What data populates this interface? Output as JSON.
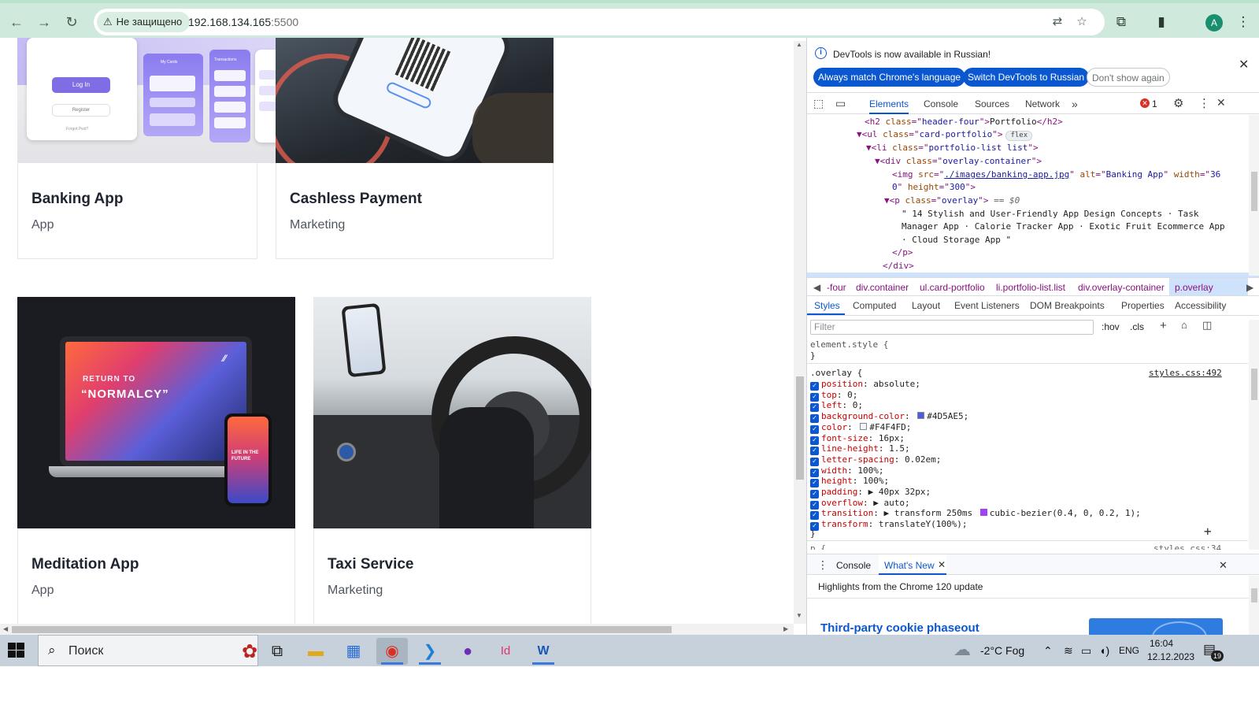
{
  "browser": {
    "security_label": "Не защищено",
    "url_host": "192.168.134.165",
    "url_port": ":5500",
    "profile_initial": "A",
    "icons": [
      "back-arrow-icon",
      "forward-arrow-icon",
      "reload-icon",
      "translate-icon",
      "star-icon",
      "extensions-icon",
      "side-panel-icon",
      "menu-dots-icon"
    ]
  },
  "page": {
    "cards": [
      {
        "title": "Banking App",
        "category": "App",
        "image_alt": "Banking App",
        "image_text": [
          "Log In",
          "Register",
          "My Cards",
          "Transactions",
          "Forgot Pwd?"
        ]
      },
      {
        "title": "Cashless Payment",
        "category": "Marketing"
      },
      {
        "title": "Meditation App",
        "category": "App",
        "image_text": [
          "RETURN TO",
          "“NORMALCY”",
          "LIFE IN THE FUTURE"
        ]
      },
      {
        "title": "Taxi Service",
        "category": "Marketing"
      }
    ]
  },
  "devtools": {
    "info_text": "DevTools is now available in Russian!",
    "btn_match": "Always match Chrome's language",
    "btn_switch": "Switch DevTools to Russian",
    "btn_dismiss": "Don't show again",
    "tabs": [
      "Elements",
      "Console",
      "Sources",
      "Network"
    ],
    "active_tab": "Elements",
    "error_count": "1",
    "dom": {
      "h2_class": "header-four",
      "h2_text": "Portfolio",
      "ul_class": "card-portfolio",
      "flex_badge": "flex",
      "li_class": "portfolio-list list",
      "div_class": "overlay-container",
      "img_src": "./images/banking-app.jpg",
      "img_alt": "Banking App",
      "img_width": "360",
      "img_height": "300",
      "p_class": "overlay",
      "selected_marker": "== $0",
      "p_text_1": "\" 14 Stylish and User-Friendly App Design Concepts · Task",
      "p_text_2": "Manager App · Calorie Tracker App · Exotic Fruit Ecommerce App",
      "p_text_3": "· Cloud Storage App \""
    },
    "breadcrumbs": [
      "-four",
      "div.container",
      "ul.card-portfolio",
      "li.portfolio-list.list",
      "div.overlay-container",
      "p.overlay"
    ],
    "styles_tabs": [
      "Styles",
      "Computed",
      "Layout",
      "Event Listeners",
      "DOM Breakpoints",
      "Properties",
      "Accessibility"
    ],
    "filter_placeholder": "Filter",
    "hov": ":hov",
    "cls": ".cls",
    "element_style": "element.style {",
    "rule_selector": ".overlay {",
    "rule_source": "styles.css:492",
    "properties": [
      {
        "name": "position",
        "value": "absolute;"
      },
      {
        "name": "top",
        "value": "0;"
      },
      {
        "name": "left",
        "value": "0;"
      },
      {
        "name": "background-color",
        "value": "#4D5AE5;",
        "swatch": "#4D5AE5"
      },
      {
        "name": "color",
        "value": "#F4F4FD;",
        "swatch": "#F4F4FD"
      },
      {
        "name": "font-size",
        "value": "16px;"
      },
      {
        "name": "line-height",
        "value": "1.5;"
      },
      {
        "name": "letter-spacing",
        "value": "0.02em;"
      },
      {
        "name": "width",
        "value": "100%;"
      },
      {
        "name": "height",
        "value": "100%;"
      },
      {
        "name": "padding",
        "value": "▶ 40px 32px;"
      },
      {
        "name": "overflow",
        "value": "▶ auto;"
      },
      {
        "name": "transition",
        "value": "▶ transform 250ms",
        "extra": "cubic-bezier(0.4, 0, 0.2, 1);"
      },
      {
        "name": "transform",
        "value": "translateY(100%);"
      }
    ],
    "next_rule_source": "styles.css:34",
    "drawer_tabs": [
      "Console",
      "What's New"
    ],
    "drawer_text": "Highlights from the Chrome 120 update",
    "drawer_heading": "Third-party cookie phaseout"
  },
  "taskbar": {
    "search_label": "Поиск",
    "weather": "-2°C  Fog",
    "lang": "ENG",
    "time": "16:04",
    "date": "12.12.2023",
    "notifications": "19"
  }
}
